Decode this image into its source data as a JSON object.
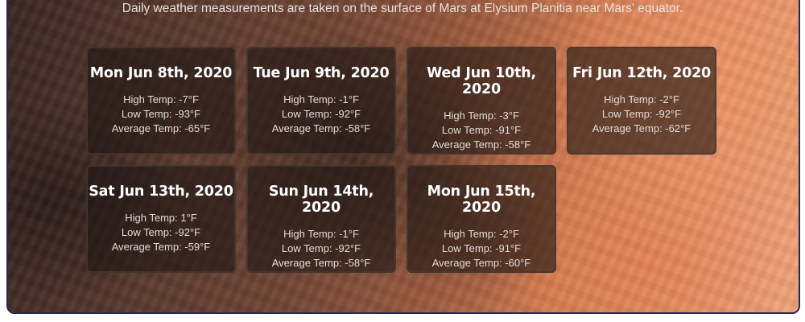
{
  "subtitle": "Daily weather measurements are taken on the surface of Mars at Elysium Planitia near Mars' equator.",
  "days": [
    {
      "date": "Mon Jun 8th, 2020",
      "high": "High Temp: -7°F",
      "low": "Low Temp: -93°F",
      "avg": "Average Temp: -65°F"
    },
    {
      "date": "Tue Jun 9th, 2020",
      "high": "High Temp: -1°F",
      "low": "Low Temp: -92°F",
      "avg": "Average Temp: -58°F"
    },
    {
      "date": "Wed Jun 10th, 2020",
      "high": "High Temp: -3°F",
      "low": "Low Temp: -91°F",
      "avg": "Average Temp: -58°F"
    },
    {
      "date": "Fri Jun 12th, 2020",
      "high": "High Temp: -2°F",
      "low": "Low Temp: -92°F",
      "avg": "Average Temp: -62°F"
    },
    {
      "date": "Sat Jun 13th, 2020",
      "high": "High Temp: 1°F",
      "low": "Low Temp: -92°F",
      "avg": "Average Temp: -59°F"
    },
    {
      "date": "Sun Jun 14th, 2020",
      "high": "High Temp: -1°F",
      "low": "Low Temp: -92°F",
      "avg": "Average Temp: -58°F"
    },
    {
      "date": "Mon Jun 15th, 2020",
      "high": "High Temp: -2°F",
      "low": "Low Temp: -91°F",
      "avg": "Average Temp: -60°F"
    }
  ]
}
